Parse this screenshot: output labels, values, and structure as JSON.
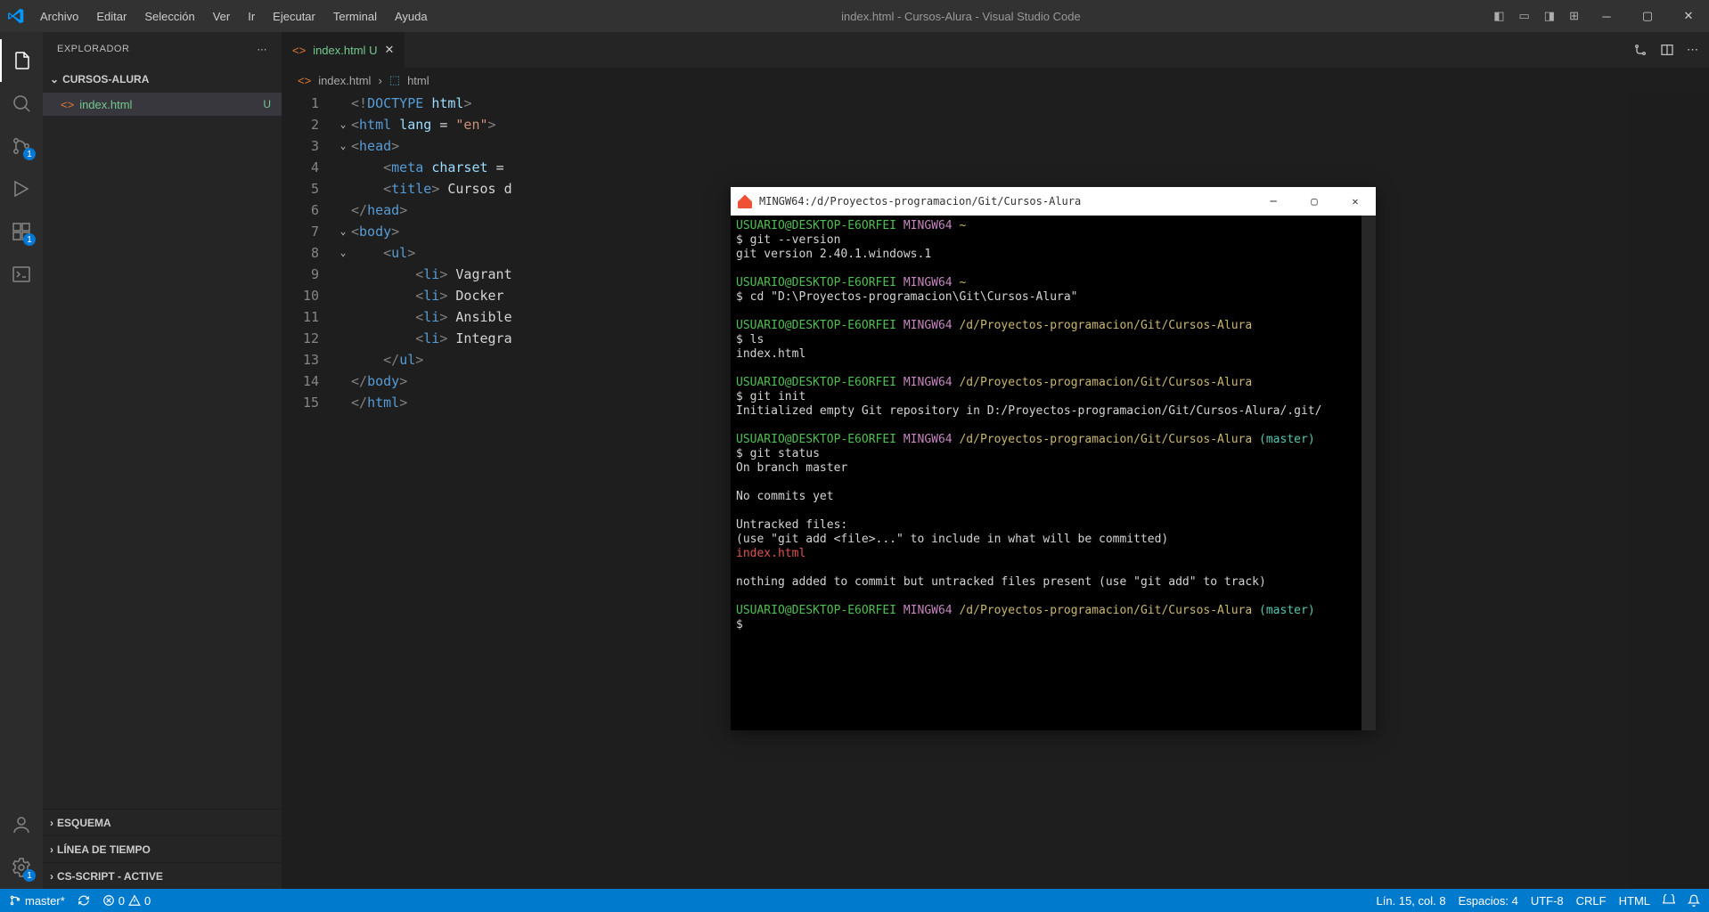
{
  "titlebar": {
    "menus": [
      "Archivo",
      "Editar",
      "Selección",
      "Ver",
      "Ir",
      "Ejecutar",
      "Terminal",
      "Ayuda"
    ],
    "title": "index.html - Cursos-Alura - Visual Studio Code"
  },
  "activity": {
    "scm_badge": "1",
    "ext_badge": "1",
    "gear_badge": "1"
  },
  "sidebar": {
    "header": "EXPLORADOR",
    "project": "CURSOS-ALURA",
    "files": [
      {
        "name": "index.html",
        "status": "U"
      }
    ],
    "sections": [
      "ESQUEMA",
      "LÍNEA DE TIEMPO",
      "CS-SCRIPT - ACTIVE"
    ]
  },
  "tab": {
    "name": "index.html",
    "status": "U"
  },
  "breadcrumb": {
    "file": "index.html",
    "node": "html"
  },
  "code": {
    "lines": [
      {
        "n": "1",
        "fold": "",
        "html": "<span class='c-brk'>&lt;!</span><span class='c-doctype'>DOCTYPE</span> <span class='c-attr'>html</span><span class='c-brk'>&gt;</span>"
      },
      {
        "n": "2",
        "fold": "v",
        "html": "<span class='c-brk'>&lt;</span><span class='c-tag'>html</span> <span class='c-attr'>lang</span> <span class='c-txt'>=</span> <span class='c-str'>\"en\"</span><span class='c-brk'>&gt;</span>"
      },
      {
        "n": "3",
        "fold": "v",
        "html": "<span class='c-brk'>&lt;</span><span class='c-tag'>head</span><span class='c-brk'>&gt;</span>"
      },
      {
        "n": "4",
        "fold": "",
        "html": "    <span class='c-brk'>&lt;</span><span class='c-tag'>meta</span> <span class='c-attr'>charset</span> <span class='c-txt'>=</span>"
      },
      {
        "n": "5",
        "fold": "",
        "html": "    <span class='c-brk'>&lt;</span><span class='c-tag'>title</span><span class='c-brk'>&gt;</span> <span class='c-txt'>Cursos d</span>"
      },
      {
        "n": "6",
        "fold": "",
        "html": "<span class='c-brk'>&lt;/</span><span class='c-tag'>head</span><span class='c-brk'>&gt;</span>"
      },
      {
        "n": "7",
        "fold": "v",
        "html": "<span class='c-brk'>&lt;</span><span class='c-tag'>body</span><span class='c-brk'>&gt;</span>"
      },
      {
        "n": "8",
        "fold": "v",
        "html": "    <span class='c-brk'>&lt;</span><span class='c-tag'>ul</span><span class='c-brk'>&gt;</span>"
      },
      {
        "n": "9",
        "fold": "",
        "html": "        <span class='c-brk'>&lt;</span><span class='c-tag'>li</span><span class='c-brk'>&gt;</span> <span class='c-txt'>Vagrant</span>"
      },
      {
        "n": "10",
        "fold": "",
        "html": "        <span class='c-brk'>&lt;</span><span class='c-tag'>li</span><span class='c-brk'>&gt;</span> <span class='c-txt'>Docker</span>"
      },
      {
        "n": "11",
        "fold": "",
        "html": "        <span class='c-brk'>&lt;</span><span class='c-tag'>li</span><span class='c-brk'>&gt;</span> <span class='c-txt'>Ansible</span>"
      },
      {
        "n": "12",
        "fold": "",
        "html": "        <span class='c-brk'>&lt;</span><span class='c-tag'>li</span><span class='c-brk'>&gt;</span> <span class='c-txt'>Integra</span>"
      },
      {
        "n": "13",
        "fold": "",
        "html": "    <span class='c-brk'>&lt;/</span><span class='c-tag'>ul</span><span class='c-brk'>&gt;</span>"
      },
      {
        "n": "14",
        "fold": "",
        "html": "<span class='c-brk'>&lt;/</span><span class='c-tag'>body</span><span class='c-brk'>&gt;</span>"
      },
      {
        "n": "15",
        "fold": "",
        "html": "<span class='c-brk'>&lt;/</span><span class='c-tag'>html</span><span class='c-brk'>&gt;</span>"
      }
    ]
  },
  "terminal": {
    "title": "MINGW64:/d/Proyectos-programacion/Git/Cursos-Alura",
    "prompt_user": "USUARIO@DESKTOP-E6ORFEI",
    "prompt_shell": "MINGW64",
    "home": "~",
    "path": "/d/Proyectos-programacion/Git/Cursos-Alura",
    "branch": "(master)",
    "lines": {
      "cmd1": "$ git --version",
      "out1": "git version 2.40.1.windows.1",
      "cmd2": "$ cd \"D:\\Proyectos-programacion\\Git\\Cursos-Alura\"",
      "cmd3": "$ ls",
      "out3": "index.html",
      "cmd4": "$ git init",
      "out4": "Initialized empty Git repository in D:/Proyectos-programacion/Git/Cursos-Alura/.git/",
      "cmd5": "$ git status",
      "out5a": "On branch master",
      "out5b": "No commits yet",
      "out5c": "Untracked files:",
      "out5d": "  (use \"git add <file>...\" to include in what will be committed)",
      "out5e": "        index.html",
      "out5f": "nothing added to commit but untracked files present (use \"git add\" to track)",
      "cmd6": "$"
    }
  },
  "statusbar": {
    "branch": "master*",
    "errors": "0",
    "warnings": "0",
    "cursor": "Lín. 15, col. 8",
    "spaces": "Espacios: 4",
    "encoding": "UTF-8",
    "eol": "CRLF",
    "lang": "HTML"
  }
}
